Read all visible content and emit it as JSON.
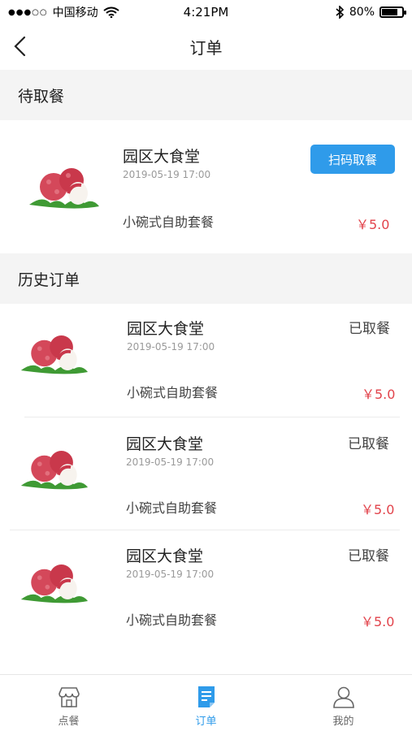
{
  "status_bar": {
    "carrier": "中国移动",
    "time": "4:21PM",
    "battery": "80%",
    "battery_level": 0.8
  },
  "nav": {
    "title": "订单",
    "back_icon": "chevron-left-icon"
  },
  "pending": {
    "header": "待取餐",
    "orders": [
      {
        "name": "园区大食堂",
        "date": "2019-05-19  17:00",
        "meal": "小碗式自助套餐",
        "price": "￥5.0",
        "action": "扫码取餐",
        "image": "lychee-image"
      }
    ]
  },
  "history": {
    "header": "历史订单",
    "orders": [
      {
        "name": "园区大食堂",
        "date": "2019-05-19  17:00",
        "meal": "小碗式自助套餐",
        "price": "￥5.0",
        "status": "已取餐",
        "image": "lychee-image"
      },
      {
        "name": "园区大食堂",
        "date": "2019-05-19  17:00",
        "meal": "小碗式自助套餐",
        "price": "￥5.0",
        "status": "已取餐",
        "image": "lychee-image"
      },
      {
        "name": "园区大食堂",
        "date": "2019-05-19  17:00",
        "meal": "小碗式自助套餐",
        "price": "￥5.0",
        "status": "已取餐",
        "image": "lychee-image"
      }
    ]
  },
  "tabs": [
    {
      "label": "点餐",
      "icon": "store-icon",
      "active": false
    },
    {
      "label": "订单",
      "icon": "order-doc-icon",
      "active": true
    },
    {
      "label": "我的",
      "icon": "user-icon",
      "active": false
    }
  ],
  "colors": {
    "accent": "#2f9bea",
    "price": "#e2434b",
    "inactive_tab": "#666666",
    "section_bg": "#f4f4f4"
  }
}
